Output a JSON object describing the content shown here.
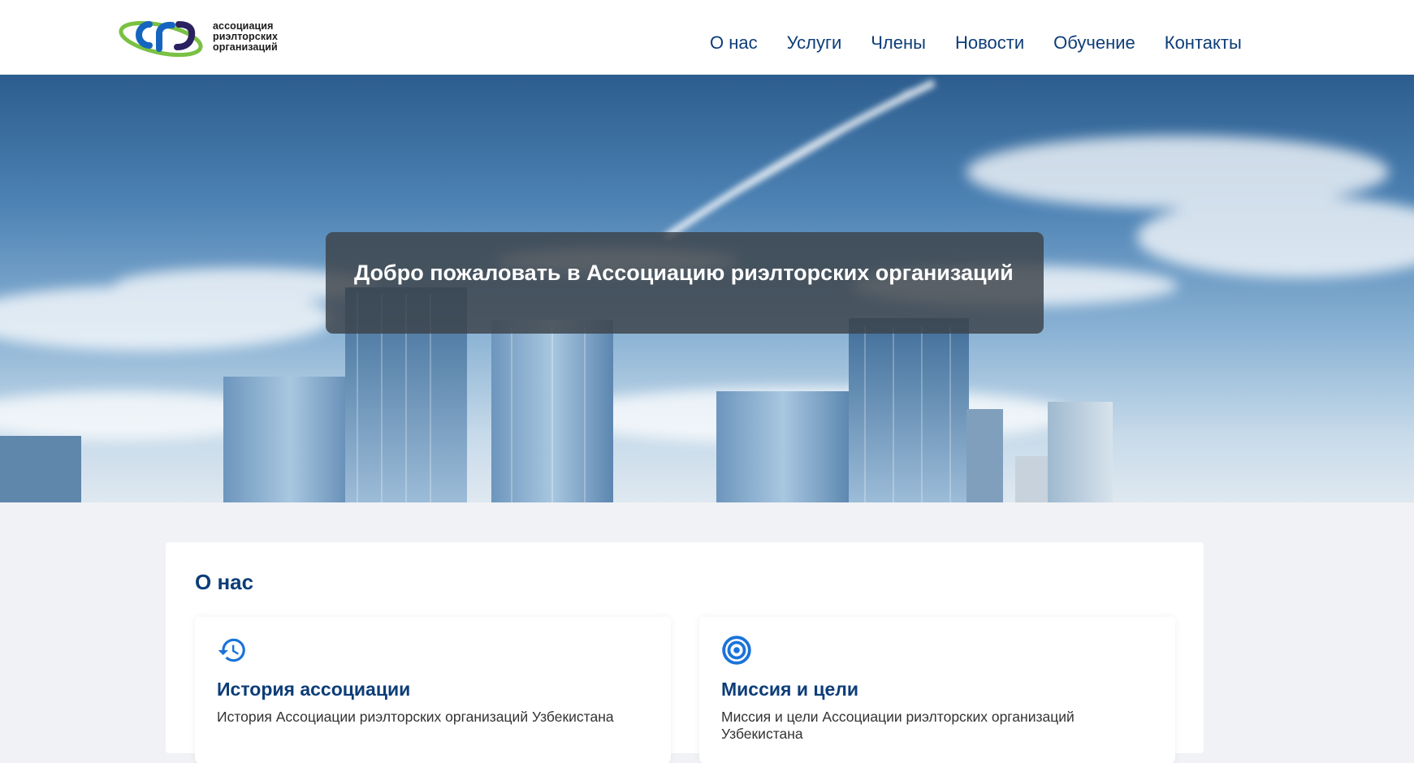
{
  "brand": {
    "logo_letters": "cro",
    "name_lines": [
      "ассоциация",
      "риэлторских",
      "организаций"
    ],
    "colors": {
      "blue": "#1565c0",
      "green": "#7ac143",
      "purple": "#2b2160"
    }
  },
  "nav": {
    "items": [
      {
        "label": "О нас"
      },
      {
        "label": "Услуги"
      },
      {
        "label": "Члены"
      },
      {
        "label": "Новости"
      },
      {
        "label": "Обучение"
      },
      {
        "label": "Контакты"
      }
    ]
  },
  "hero": {
    "title": "Добро пожаловать в Ассоциацию риэлторских организаций"
  },
  "about": {
    "heading": "О нас",
    "cards": [
      {
        "icon": "history-icon",
        "title": "История ассоциации",
        "text": "История Ассоциации риэлторских организаций Узбекистана"
      },
      {
        "icon": "target-icon",
        "title": "Миссия и цели",
        "text": "Миссия и цели Ассоциации риэлторских организаций Узбекистана"
      }
    ]
  },
  "colors": {
    "nav_text": "#0d3d78",
    "accent": "#1a73d9",
    "page_bg": "#f0f2f5"
  }
}
